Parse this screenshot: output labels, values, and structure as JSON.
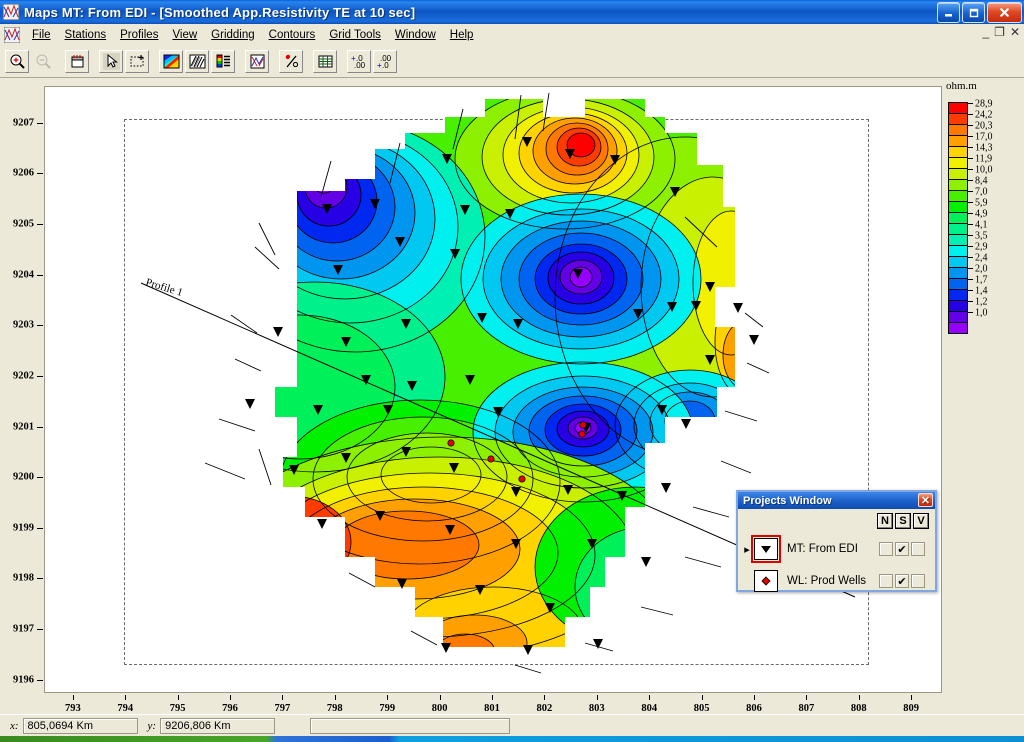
{
  "window": {
    "app_name": "Maps",
    "title": "Maps  MT: From EDI - [Smoothed App.Resistivity TE at 10 sec]",
    "icon": "maps-app-icon",
    "minimize_label": "_",
    "maximize_label": "❐",
    "close_label": "✕",
    "mdi_minimize_label": "_",
    "mdi_restore_label": "❐",
    "mdi_close_label": "✕"
  },
  "menubar": {
    "items": [
      {
        "label": "File",
        "accel": "F"
      },
      {
        "label": "Stations",
        "accel": "S"
      },
      {
        "label": "Profiles",
        "accel": "P"
      },
      {
        "label": "View",
        "accel": "V"
      },
      {
        "label": "Gridding",
        "accel": "G"
      },
      {
        "label": "Contours",
        "accel": "C"
      },
      {
        "label": "Grid Tools",
        "accel": "T"
      },
      {
        "label": "Window",
        "accel": "W"
      },
      {
        "label": "Help",
        "accel": "H"
      }
    ]
  },
  "toolbar": {
    "buttons": [
      {
        "name": "zoom-in-icon",
        "enabled": true
      },
      {
        "name": "zoom-out-icon",
        "enabled": false
      },
      {
        "name": "zoom-window-icon",
        "enabled": true
      },
      {
        "name": "pointer-select-icon",
        "enabled": true,
        "pressed": true
      },
      {
        "name": "rubber-band-select-icon",
        "enabled": true
      },
      {
        "name": "color-palette-icon",
        "enabled": true
      },
      {
        "name": "hatch-fill-icon",
        "enabled": true
      },
      {
        "name": "color-legend-icon",
        "enabled": true
      },
      {
        "name": "grid-overlay-icon",
        "enabled": true
      },
      {
        "name": "station-markers-icon",
        "enabled": true
      },
      {
        "name": "data-table-icon",
        "enabled": true
      },
      {
        "name": "increase-decimals-icon",
        "enabled": true
      },
      {
        "name": "decrease-decimals-icon",
        "enabled": true
      }
    ]
  },
  "projects_window": {
    "title": "Projects Window",
    "close_label": "✕",
    "columns": [
      "N",
      "S",
      "V"
    ],
    "rows": [
      {
        "symbol": "down-triangle-icon",
        "label": "MT: From EDI",
        "selected": true,
        "current_marker": "▸",
        "checks": [
          false,
          true,
          false
        ]
      },
      {
        "symbol": "well-diamond-icon",
        "label": "WL: Prod Wells",
        "selected": false,
        "current_marker": "",
        "checks": [
          false,
          true,
          false
        ]
      }
    ],
    "check_mark": "✔"
  },
  "statusbar": {
    "x_label": "x:",
    "x_value": "805,0694 Km",
    "y_label": "y:",
    "y_value": "9206,806 Km",
    "message": ""
  },
  "chart_data": {
    "type": "heatmap",
    "title": "Smoothed App.Resistivity TE at 10 sec",
    "xlabel": "",
    "ylabel": "",
    "xlim": [
      792.45,
      809.55
    ],
    "ylim": [
      9195.6,
      9207.55
    ],
    "grid": false,
    "legend_position": "right",
    "colorbar": {
      "unit_label": "ohm.m",
      "tick_labels": [
        "28,9",
        "24,2",
        "20,3",
        "17,0",
        "14,3",
        "11,9",
        "10,0",
        "8,4",
        "7,0",
        "5,9",
        "4,9",
        "4,1",
        "3,5",
        "2,9",
        "2,4",
        "2,0",
        "1,7",
        "1,4",
        "1,2",
        "1,0"
      ],
      "tick_values": [
        28.9,
        24.2,
        20.3,
        17.0,
        14.3,
        11.9,
        10.0,
        8.4,
        7.0,
        5.9,
        4.9,
        4.1,
        3.5,
        2.9,
        2.4,
        2.0,
        1.7,
        1.4,
        1.2,
        1.0
      ],
      "colors": [
        "#FF0000",
        "#FF3C00",
        "#FF7800",
        "#FFA000",
        "#FFD200",
        "#F0F000",
        "#C8F000",
        "#8CF000",
        "#46F000",
        "#00F000",
        "#00F05A",
        "#00F08C",
        "#00F0B4",
        "#00F0F0",
        "#00C8F0",
        "#0096F0",
        "#0064F0",
        "#0028F0",
        "#2800E6",
        "#6400E6",
        "#9600FF"
      ]
    },
    "x_ticks": [
      793,
      794,
      795,
      796,
      797,
      798,
      799,
      800,
      801,
      802,
      803,
      804,
      805,
      806,
      807,
      808,
      809
    ],
    "x_tick_labels": [
      "793",
      "794",
      "795",
      "796",
      "797",
      "798",
      "799",
      "800",
      "801",
      "802",
      "803",
      "804",
      "805",
      "806",
      "807",
      "808",
      "809"
    ],
    "y_ticks": [
      9196,
      9197,
      9198,
      9199,
      9200,
      9201,
      9202,
      9203,
      9204,
      9205,
      9206,
      9207
    ],
    "y_tick_labels": [
      "9196",
      "9197",
      "9198",
      "9199",
      "9200",
      "9201",
      "9202",
      "9203",
      "9204",
      "9205",
      "9206",
      "9207"
    ],
    "annotations": [
      {
        "text": "Profile 1",
        "x": 794.0,
        "y": 9203.1,
        "rotation": 17
      }
    ],
    "features": {
      "profile_line_label": "Profile 1",
      "station_marker": "down-triangle",
      "well_marker": "red-dot",
      "highs": [
        {
          "label": "resistivity high",
          "x": 801.8,
          "y": 9205.9,
          "value": 28.9
        },
        {
          "label": "resistivity high",
          "x": 797.0,
          "y": 9199.1,
          "value": 28.9
        },
        {
          "label": "resistivity high",
          "x": 800.6,
          "y": 9199.3,
          "value": 20.3
        }
      ],
      "lows": [
        {
          "label": "resistivity low",
          "x": 795.6,
          "y": 9204.6,
          "value": 1.0
        },
        {
          "label": "resistivity low",
          "x": 801.0,
          "y": 9203.9,
          "value": 1.0
        },
        {
          "label": "resistivity low",
          "x": 801.1,
          "y": 9200.2,
          "value": 1.0
        },
        {
          "label": "resistivity low",
          "x": 803.4,
          "y": 9201.8,
          "value": 2.4
        }
      ]
    }
  }
}
